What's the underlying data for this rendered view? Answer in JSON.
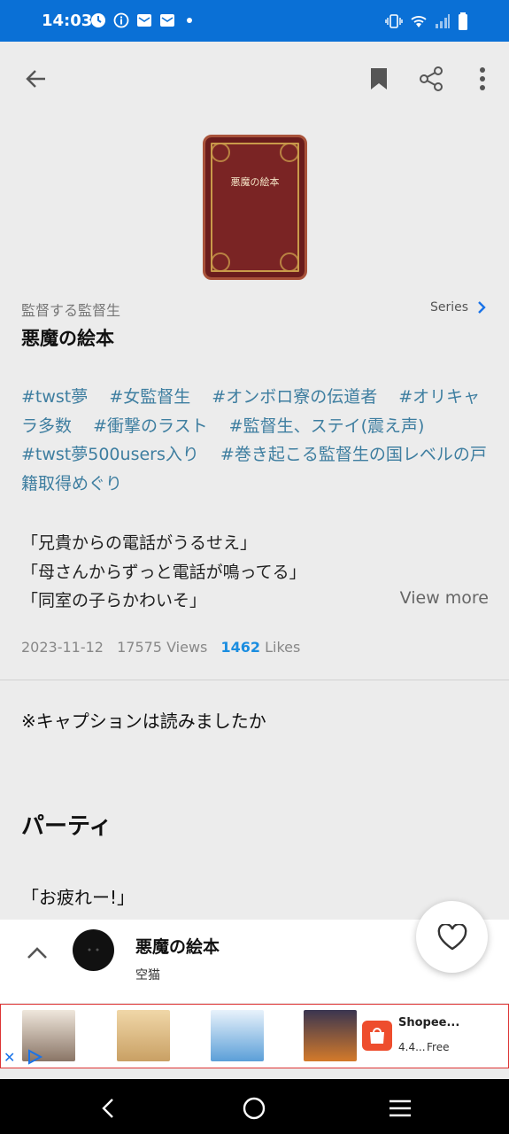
{
  "status_bar": {
    "time": "14:03",
    "left_icons": [
      "sync-icon",
      "info-icon",
      "mail-icon",
      "mail-icon",
      "dot-icon"
    ],
    "right_icons": [
      "vibrate-icon",
      "wifi-icon",
      "signal-icon",
      "battery-icon"
    ]
  },
  "app_bar": {
    "back_icon": "arrow-left-icon",
    "bookmark_icon": "bookmark-icon",
    "share_icon": "share-icon",
    "more_icon": "more-vertical-icon"
  },
  "cover": {
    "title": "悪魔の絵本"
  },
  "work": {
    "series_name": "監督する監督生",
    "series_label": "Series",
    "title": "悪魔の絵本",
    "tags": [
      "#twst夢",
      "#女監督生",
      "#オンボロ寮の伝道者",
      "#オリキャラ多数",
      "#衝撃のラスト",
      "#監督生、ステイ(震え声)",
      "#twst夢500users入り",
      "#巻き起こる監督生の国レベルの戸籍取得めぐり"
    ],
    "caption_lines": [
      "「兄貴からの電話がうるせえ」",
      "「母さんからずっと電話が鳴ってる」",
      "「同室の子らかわいそ」"
    ],
    "view_more": "View more",
    "date": "2023-11-12",
    "views": "17575 Views",
    "likes_count": "1462",
    "likes_label": "Likes"
  },
  "body": {
    "line1": "※キャプションは読みましたか",
    "heading": "パーティ",
    "line2": "「お疲れー!」"
  },
  "bottom_bar": {
    "title": "悪魔の絵本",
    "author": "空猫",
    "heart_icon": "heart-icon"
  },
  "ad": {
    "shop_name": "Shopee...",
    "rating": "4.4...",
    "price": "Free"
  },
  "colors": {
    "status_bar": "#0a70d6",
    "tag": "#3e7ea0",
    "likes": "#1a8de0",
    "series_chevron": "#1a73e8"
  }
}
